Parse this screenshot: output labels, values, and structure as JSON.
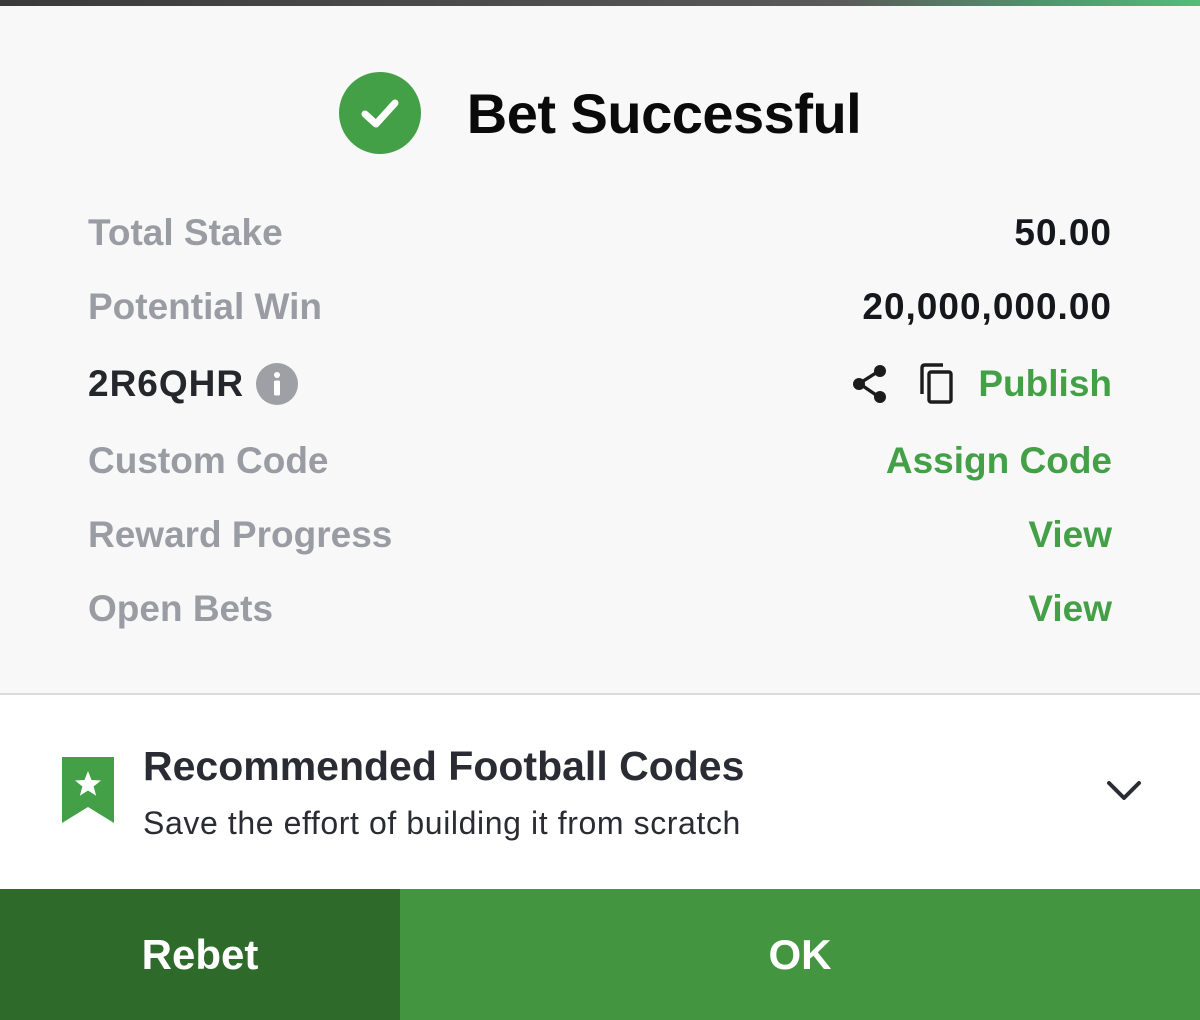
{
  "header": {
    "title": "Bet Successful",
    "icon": "check-circle-icon",
    "icon_color": "#43a047"
  },
  "summary": {
    "total_stake": {
      "label": "Total Stake",
      "value": "50.00"
    },
    "potential_win": {
      "label": "Potential Win",
      "value": "20,000,000.00"
    },
    "booking_code": {
      "code": "2R6QHR",
      "info_icon": "info-icon",
      "share_icon": "share-icon",
      "copy_icon": "copy-icon",
      "publish_label": "Publish"
    },
    "custom_code": {
      "label": "Custom Code",
      "action": "Assign Code"
    },
    "reward_progress": {
      "label": "Reward Progress",
      "action": "View"
    },
    "open_bets": {
      "label": "Open Bets",
      "action": "View"
    }
  },
  "recommend": {
    "icon": "bookmark-star-icon",
    "title": "Recommended Football Codes",
    "subtitle": "Save the effort of building it from scratch",
    "chevron": "chevron-down-icon"
  },
  "footer": {
    "rebet_label": "Rebet",
    "ok_label": "OK"
  },
  "colors": {
    "accent": "#43a047",
    "rebet_bg": "#2e6b2a",
    "ok_bg": "#43963f"
  }
}
